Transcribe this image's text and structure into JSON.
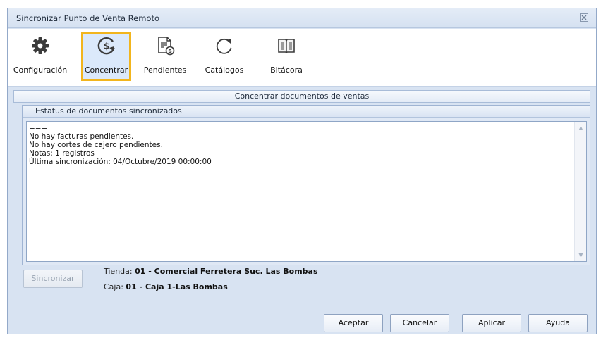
{
  "window": {
    "title": "Sincronizar Punto de Venta Remoto"
  },
  "toolbar": {
    "items": [
      {
        "label": "Configuración",
        "icon": "gear-icon"
      },
      {
        "label": "Concentrar",
        "icon": "money-sync-icon",
        "active": true
      },
      {
        "label": "Pendientes",
        "icon": "invoice-pending-icon"
      },
      {
        "label": "Catálogos",
        "icon": "refresh-icon"
      },
      {
        "label": "Bitácora",
        "icon": "book-icon"
      }
    ]
  },
  "section": {
    "title": "Concentrar documentos de ventas"
  },
  "status_group": {
    "title": "Estatus de documentos sincronizados",
    "lines": [
      "===",
      "No hay facturas pendientes.",
      "No hay cortes de cajero pendientes.",
      "Notas: 1 registros",
      "Última sincronización: 04/Octubre/2019 00:00:00"
    ]
  },
  "sync": {
    "button_label": "Sincronizar"
  },
  "store": {
    "label": "Tienda: ",
    "value": "01 - Comercial Ferretera Suc. Las Bombas"
  },
  "register": {
    "label": "Caja: ",
    "value": "01 - Caja 1-Las Bombas"
  },
  "footer": {
    "accept": "Aceptar",
    "cancel": "Cancelar",
    "apply": "Aplicar",
    "help": "Ayuda"
  },
  "colors": {
    "active_border": "#f2b51d",
    "window_bg": "#d8e3f2"
  }
}
